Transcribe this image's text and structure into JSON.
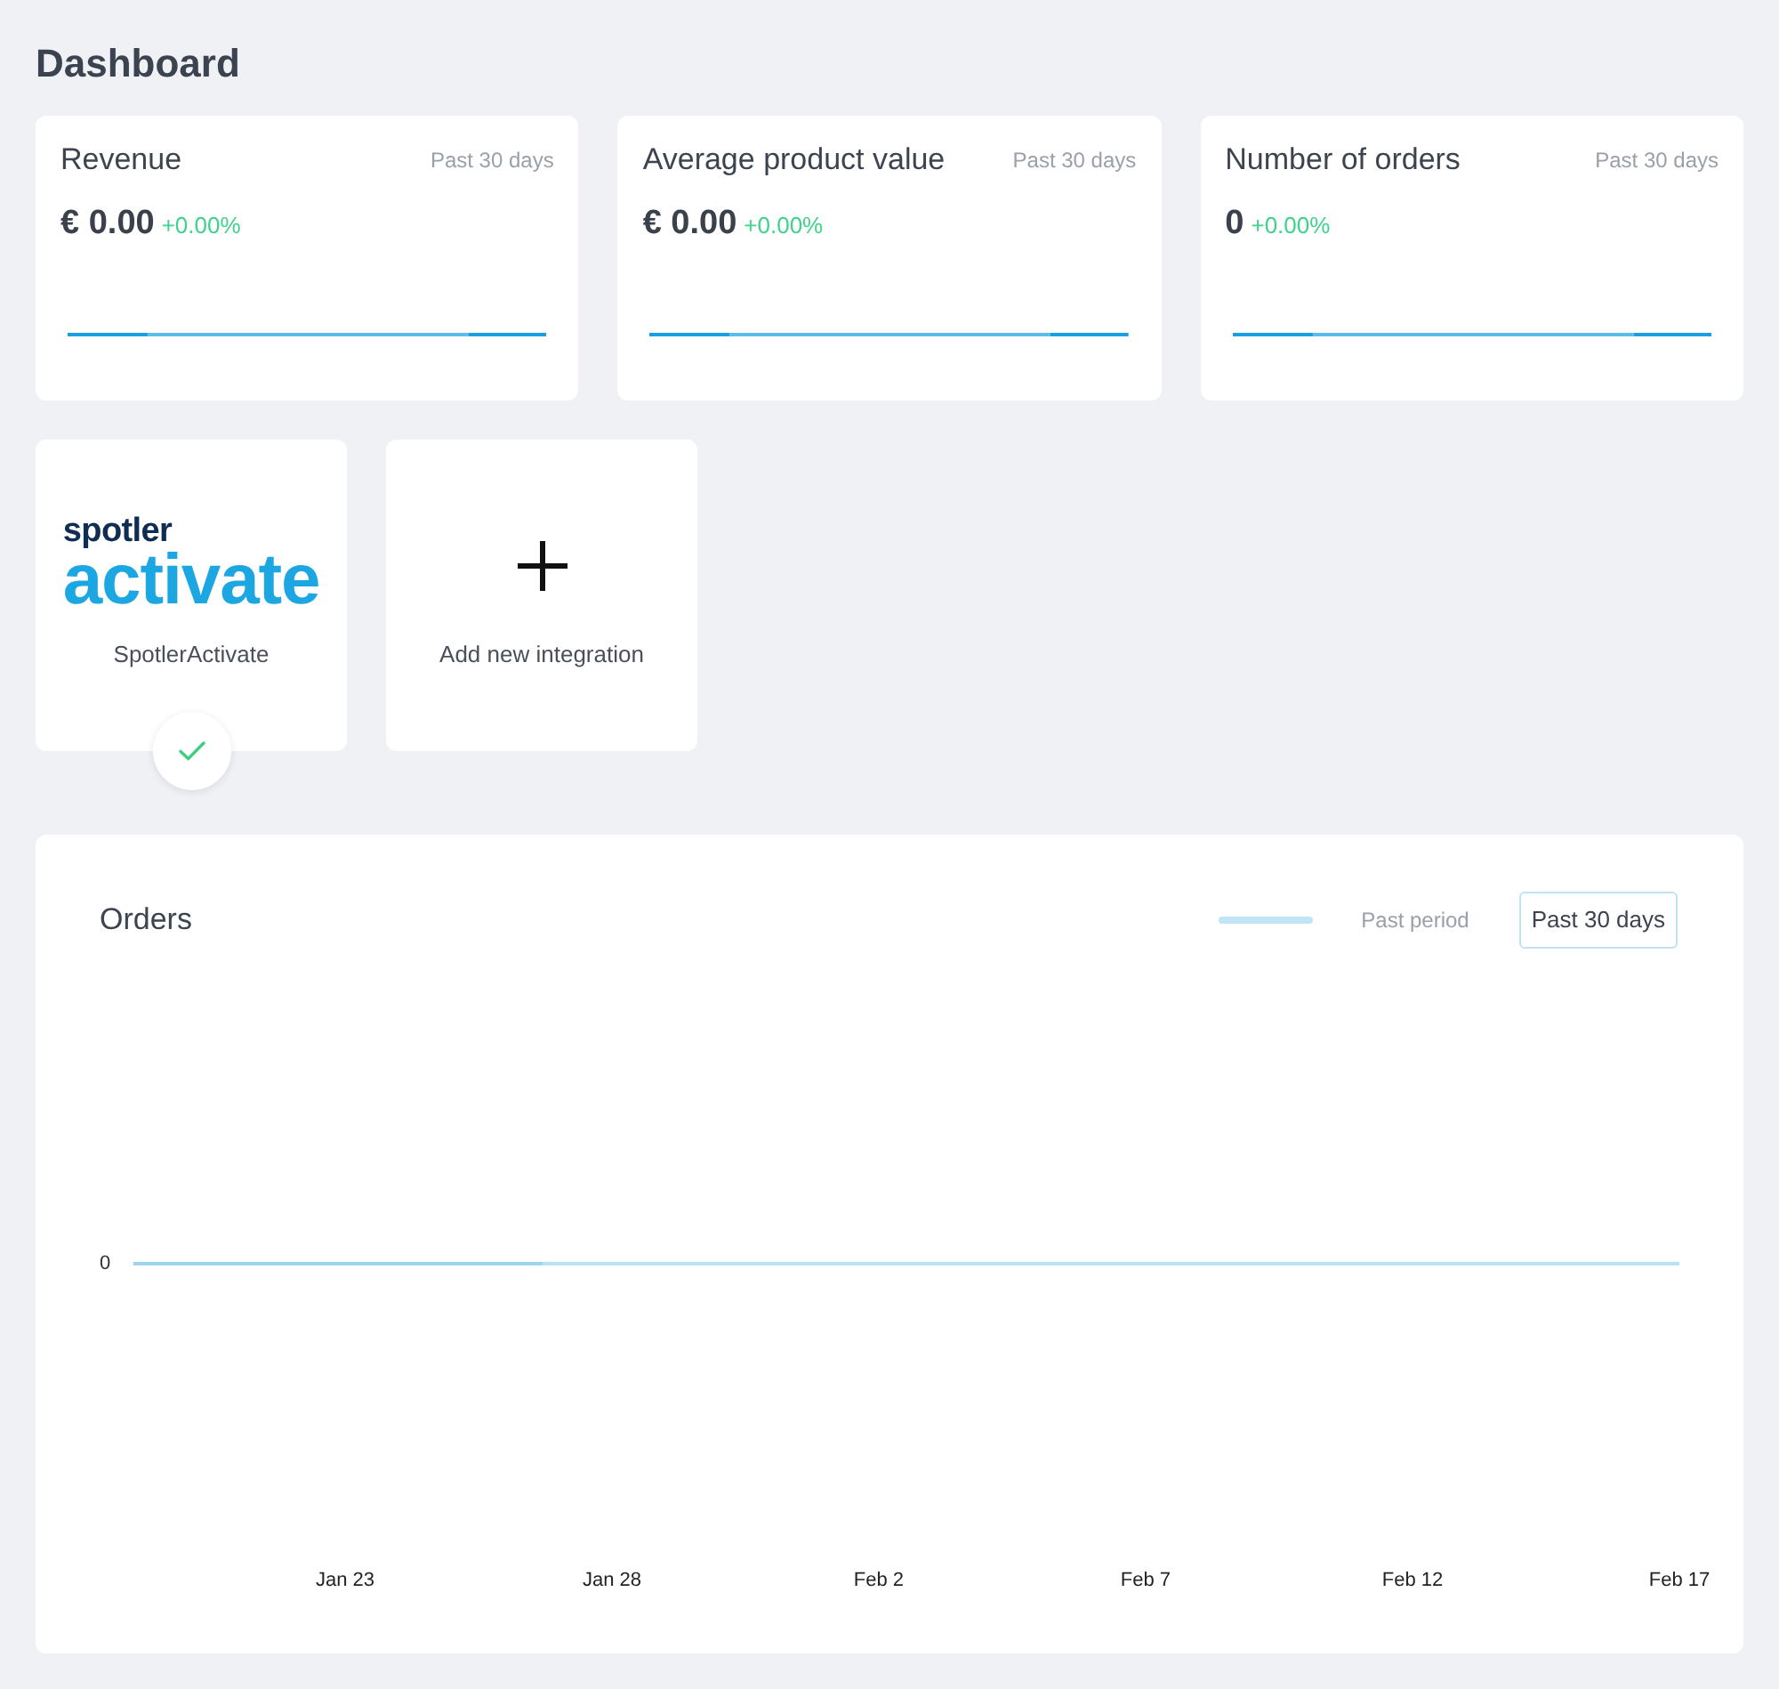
{
  "page": {
    "title": "Dashboard"
  },
  "stats": [
    {
      "title": "Revenue",
      "period": "Past 30 days",
      "value": "€ 0.00",
      "change": "+0.00%"
    },
    {
      "title": "Average product value",
      "period": "Past 30 days",
      "value": "€ 0.00",
      "change": "+0.00%"
    },
    {
      "title": "Number of orders",
      "period": "Past 30 days",
      "value": "0",
      "change": "+0.00%"
    }
  ],
  "integrations": [
    {
      "kind": "app",
      "logo_top": "spotler",
      "logo_bottom": "activate",
      "label": "SpotlerActivate",
      "connected": true
    },
    {
      "kind": "add",
      "label": "Add new integration"
    }
  ],
  "orders_chart": {
    "title": "Orders",
    "legend_label": "Past period",
    "period_button": "Past 30 days",
    "y_labels": [
      "0"
    ],
    "x_labels": [
      "Jan 23",
      "Jan 28",
      "Feb 2",
      "Feb 7",
      "Feb 12",
      "Feb 17"
    ]
  }
}
